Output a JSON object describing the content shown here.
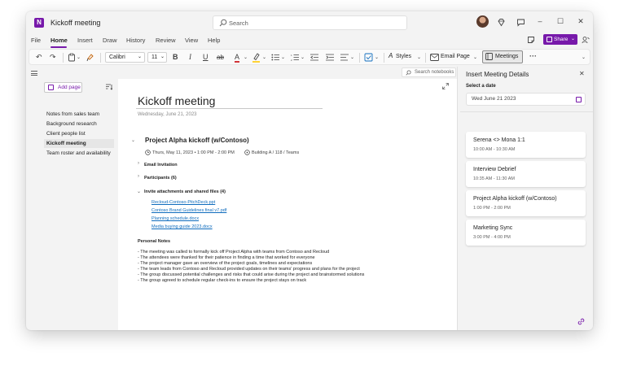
{
  "window": {
    "title": "Kickoff meeting",
    "app_icon_letter": "N"
  },
  "search": {
    "placeholder": "Search"
  },
  "menu": {
    "tabs": [
      "File",
      "Home",
      "Insert",
      "Draw",
      "History",
      "Review",
      "View",
      "Help"
    ],
    "active": "Home"
  },
  "share": {
    "label": "Share"
  },
  "ribbon": {
    "font": "Calibri",
    "size": "11",
    "bold": "B",
    "italic": "I",
    "underline": "U",
    "strike": "ab",
    "font_color_glyph": "A",
    "styles_label": "Styles",
    "email_page_label": "Email Page",
    "meetings_label": "Meetings",
    "more": "···"
  },
  "notebook_search": {
    "placeholder": "Search notebooks"
  },
  "nav": {
    "add_page_label": "Add page",
    "pages": [
      "Notes from sales team",
      "Background research",
      "Client people list",
      "Kickoff meeting",
      "Team roster and availability"
    ],
    "active_index": 3
  },
  "page": {
    "title": "Kickoff meeting",
    "date": "Wednesday, June 21, 2023",
    "meeting_heading": "Project Alpha kickoff (w/Contoso)",
    "meeting_time": "Thurs, May 11, 2023  •  1:00 PM - 2:00 PM",
    "meeting_location": "Building A / 118 / Teams",
    "email_invitation": "Email Invitation",
    "participants": "Participants (6)",
    "attachments": "Invite attachments and shared files (4)",
    "files": [
      "Recloud-Contoso-PitchDeck.ppt",
      "Contoso Brand Guidelines final v7.pdf",
      "Planning schedule.docx",
      "Media buying guide 2023.docx"
    ],
    "notes_title": "Personal Notes",
    "notes": [
      "- The meeting was called to formally kick off Project Alpha with teams from Contoso and Recloud",
      "- The attendees were thanked for their patience in finding a time that worked for everyone",
      "- The project manager gave an overview of the project goals, timelines and expectations",
      "- The team leads from Contoso and Recloud provided updates on their teams' progress and plans for the project",
      "- The group discussed potential challenges and risks that could arise during the project and brainstormed solutions",
      "- The group agreed to schedule regular check-ins to ensure the project stays on track"
    ]
  },
  "panel": {
    "title": "Insert Meeting Details",
    "date_label": "Select a date",
    "date_value": "Wed June 21 2023",
    "meetings": [
      {
        "title": "Serena <> Mona 1:1",
        "time": "10:00 AM - 10:30 AM"
      },
      {
        "title": "Interview Debrief",
        "time": "10:35 AM - 11:30 AM"
      },
      {
        "title": "Project Alpha kickoff (w/Contoso)",
        "time": "1:00 PM - 2:00 PM"
      },
      {
        "title": "Marketing Sync",
        "time": "3:00 PM - 4:00 PM"
      }
    ]
  },
  "colors": {
    "accent": "#7719aa",
    "link": "#0f6cbd",
    "font_color_bar": "#d13438",
    "highlight_bar": "#ffd335"
  }
}
